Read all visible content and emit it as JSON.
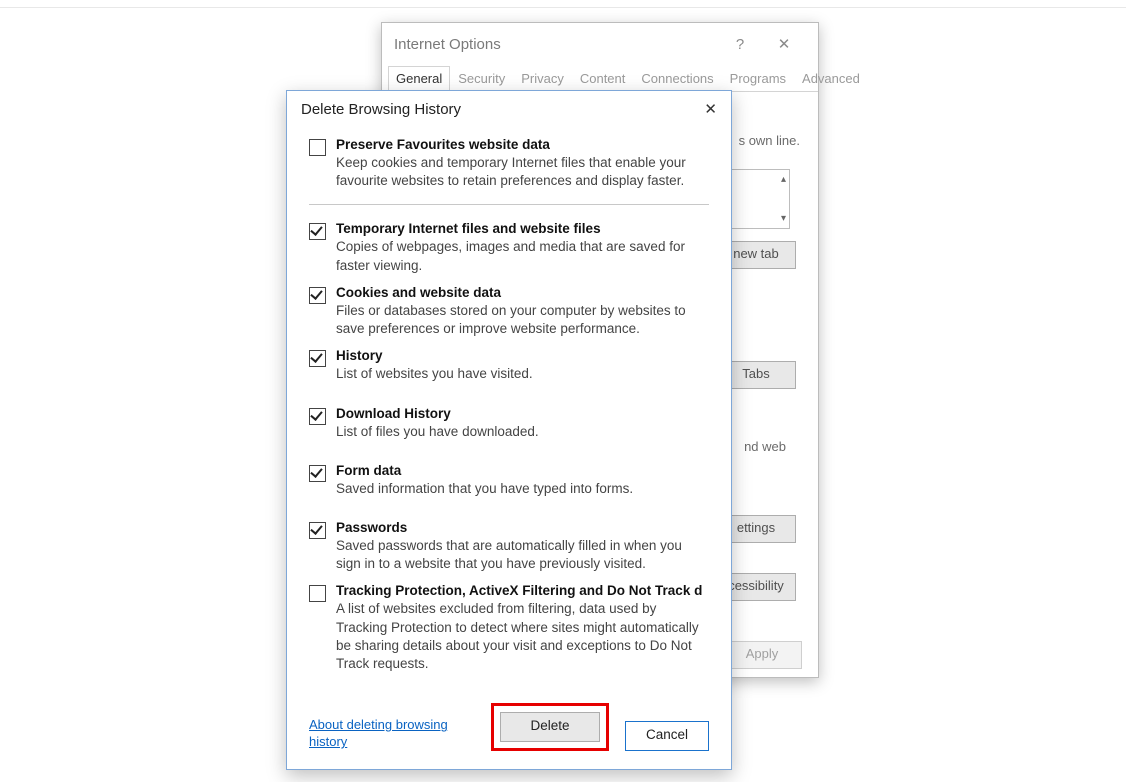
{
  "parent": {
    "title": "Internet Options",
    "help_icon": "?",
    "close_icon": "✕",
    "tabs": [
      "General",
      "Security",
      "Privacy",
      "Content",
      "Connections",
      "Programs",
      "Advanced"
    ],
    "active_tab": 0,
    "fragments": {
      "own_line": "s own line.",
      "new_tab": "new tab",
      "tabs_btn": "Tabs",
      "nd_web": "nd web",
      "settings_btn": "ettings",
      "accessibility_btn": "cessibility",
      "apply_btn": "Apply"
    }
  },
  "dialog": {
    "title": "Delete Browsing History",
    "close_icon": "✕",
    "options": [
      {
        "checked": false,
        "label": "Preserve Favourites website data",
        "desc": "Keep cookies and temporary Internet files that enable your favourite websites to retain preferences and display faster."
      },
      {
        "checked": true,
        "label": "Temporary Internet files and website files",
        "desc": "Copies of webpages, images and media that are saved for faster viewing."
      },
      {
        "checked": true,
        "label": "Cookies and website data",
        "desc": "Files or databases stored on your computer by websites to save preferences or improve website performance."
      },
      {
        "checked": true,
        "label": "History",
        "desc": "List of websites you have visited."
      },
      {
        "checked": true,
        "label": "Download History",
        "desc": "List of files you have downloaded."
      },
      {
        "checked": true,
        "label": "Form data",
        "desc": "Saved information that you have typed into forms."
      },
      {
        "checked": true,
        "label": "Passwords",
        "desc": "Saved passwords that are automatically filled in when you sign in to a website that you have previously visited."
      },
      {
        "checked": false,
        "label": "Tracking Protection, ActiveX Filtering and Do Not Track d",
        "desc": "A list of websites excluded from filtering, data used by Tracking Protection to detect where sites might automatically be sharing details about your visit and exceptions to Do Not Track requests."
      }
    ],
    "link": "About deleting browsing history",
    "delete_btn": "Delete",
    "cancel_btn": "Cancel"
  }
}
